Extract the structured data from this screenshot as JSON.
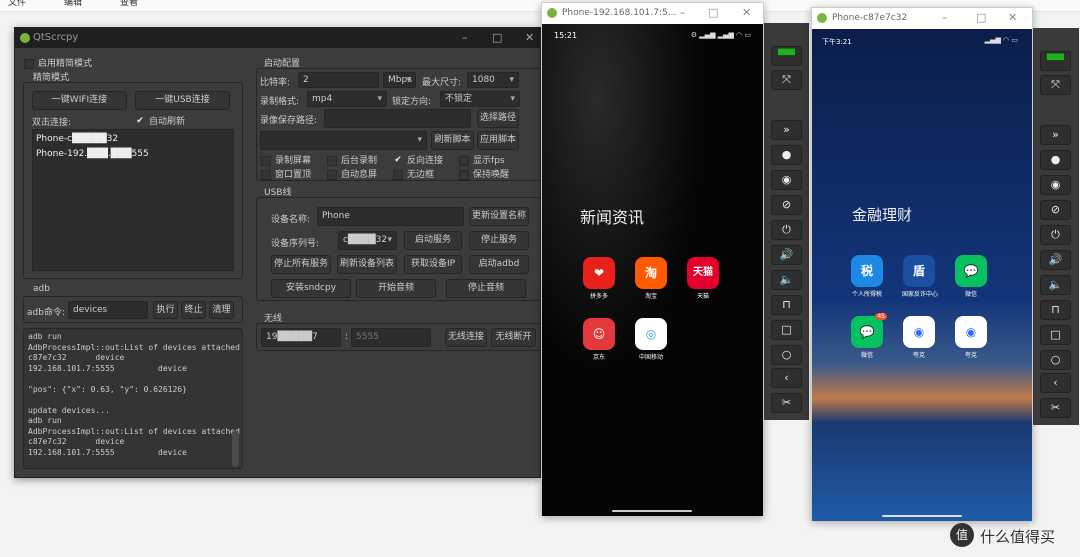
{
  "top_menu": [
    "文件",
    "编辑",
    "查看"
  ],
  "main": {
    "title": "QtScrcpy",
    "simple_mode_checkbox": "启用精简模式",
    "simple_group": "精简模式",
    "wifi_btn": "一键WIFI连接",
    "usb_btn": "一键USB连接",
    "dbl_click": "双击连接:",
    "auto_refresh": "自动刷新",
    "devices": [
      "Phone-c█████32",
      "Phone-192.███.███555"
    ],
    "adb_group": "adb",
    "adb_cmd_label": "adb命令:",
    "adb_cmd_value": "devices",
    "exec": "执行",
    "stop": "终止",
    "clear": "清理",
    "log": "adb run\nAdbProcessImpl::out:List of devices attached\nc87e7c32      device\n192.168.101.7:5555         device\n\n\"pos\": {\"x\": 0.63, \"y\": 0.626126}\n\nupdate devices...\nadb run\nAdbProcessImpl::out:List of devices attached\nc87e7c32      device\n192.168.101.7:5555         device",
    "start_cfg": {
      "label": "启动配置",
      "bitrate_label": "比特率:",
      "bitrate": "2",
      "unit": "Mbps",
      "maxsize_label": "最大尺寸:",
      "maxsize": "1080",
      "format_label": "录制格式:",
      "format": "mp4",
      "orient_label": "锁定方向:",
      "orient": "不锁定",
      "path_label": "录像保存路径:",
      "choose_path": "选择路径",
      "refresh_script": "刷新脚本",
      "apply_script": "应用脚本",
      "checks": [
        {
          "label": "录制屏幕",
          "checked": false
        },
        {
          "label": "后台录制",
          "checked": false
        },
        {
          "label": "反向连接",
          "checked": true
        },
        {
          "label": "显示fps",
          "checked": false
        },
        {
          "label": "窗口置顶",
          "checked": false
        },
        {
          "label": "自动息屏",
          "checked": false
        },
        {
          "label": "无边框",
          "checked": false
        },
        {
          "label": "保持唤醒",
          "checked": false
        }
      ]
    },
    "usb": {
      "label": "USB线",
      "name_label": "设备名称:",
      "name": "Phone",
      "update_name": "更新设置名称",
      "serial_label": "设备序列号:",
      "serial": "c████32",
      "start_srv": "启动服务",
      "stop_srv": "停止服务",
      "stop_all": "停止所有服务",
      "refresh_list": "刷新设备列表",
      "get_ip": "获取设备IP",
      "start_adbd": "启动adbd",
      "install": "安装sndcpy",
      "start_audio": "开始音频",
      "stop_audio": "停止音频"
    },
    "wireless": {
      "label": "无线",
      "ip": "19█████7",
      "sep": ":",
      "port_placeholder": "5555",
      "connect": "无线连接",
      "disconnect": "无线断开"
    }
  },
  "phone1": {
    "title": "Phone-192.168.101.7:5...",
    "time": "15:21",
    "folder": "新闻资讯",
    "apps": [
      {
        "name": "拼多多",
        "color": "#e8221b",
        "glyph": "❤"
      },
      {
        "name": "淘宝",
        "color": "#ff5a00",
        "glyph": "淘"
      },
      {
        "name": "天猫",
        "color": "#e4002b",
        "glyph": "天猫"
      },
      {
        "name": "京东",
        "color": "#e4393c",
        "glyph": "☺"
      },
      {
        "name": "中国移动",
        "color": "#ffffff",
        "glyph": "◎"
      }
    ]
  },
  "phone2": {
    "title": "Phone-c87e7c32",
    "time": "下午3:21",
    "folder": "金融理财",
    "apps": [
      {
        "name": "个人所得税",
        "color": "#1e88e5",
        "glyph": "税"
      },
      {
        "name": "国家反诈中心",
        "color": "#1a4fa0",
        "glyph": "盾"
      },
      {
        "name": "微信",
        "color": "#07c160",
        "glyph": "💬"
      },
      {
        "name": "微信",
        "color": "#07c160",
        "glyph": "💬",
        "badge": "45"
      },
      {
        "name": "夸克",
        "color": "#ffffff",
        "glyph": "◉"
      },
      {
        "name": "夸克",
        "color": "#ffffff",
        "glyph": "◉"
      }
    ]
  },
  "toolbar_icons": [
    "android-icon",
    "fullscreen-icon",
    "chevrons-down-icon",
    "record-icon",
    "eye-icon",
    "eye-off-icon",
    "power-icon",
    "volume-up-icon",
    "volume-down-icon",
    "menu-icon",
    "home-square-icon",
    "home-circle-icon",
    "back-icon",
    "screenshot-icon"
  ],
  "watermark": "什么值得买",
  "watermark_logo": "值"
}
